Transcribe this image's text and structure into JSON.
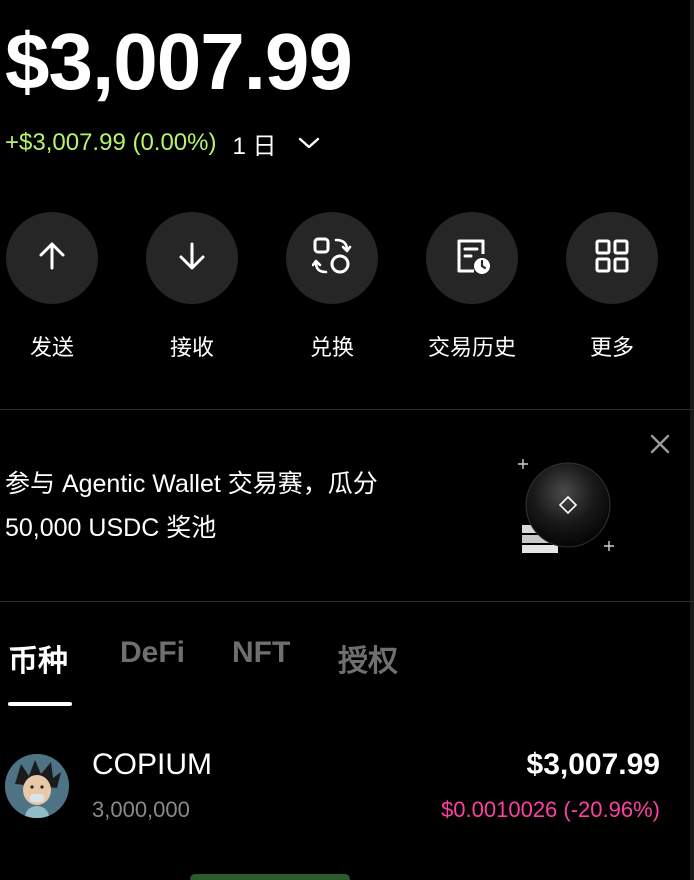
{
  "wallet": {
    "balance": "$3,007.99",
    "change": "+$3,007.99 (0.00%)",
    "period": "1 日",
    "period_icon": "chevron-down-icon",
    "change_color": "#b6f36c"
  },
  "actions": [
    {
      "label": "发送",
      "icon": "arrow-up-icon"
    },
    {
      "label": "接收",
      "icon": "arrow-down-icon"
    },
    {
      "label": "兑换",
      "icon": "swap-icon"
    },
    {
      "label": "交易历史",
      "icon": "history-icon"
    },
    {
      "label": "更多",
      "icon": "grid-icon"
    }
  ],
  "banner": {
    "line1": "参与 Agentic Wallet 交易赛，瓜分",
    "line2": "50,000 USDC 奖池",
    "close_icon": "close-icon"
  },
  "tabs": [
    {
      "label": "币种",
      "active": true
    },
    {
      "label": "DeFi",
      "active": false
    },
    {
      "label": "NFT",
      "active": false
    },
    {
      "label": "授权",
      "active": false
    }
  ],
  "tokens": [
    {
      "name": "COPIUM",
      "amount": "3,000,000",
      "value": "$3,007.99",
      "price_change": "$0.0010026 (-20.96%)",
      "change_color": "#ff3fa4"
    }
  ]
}
